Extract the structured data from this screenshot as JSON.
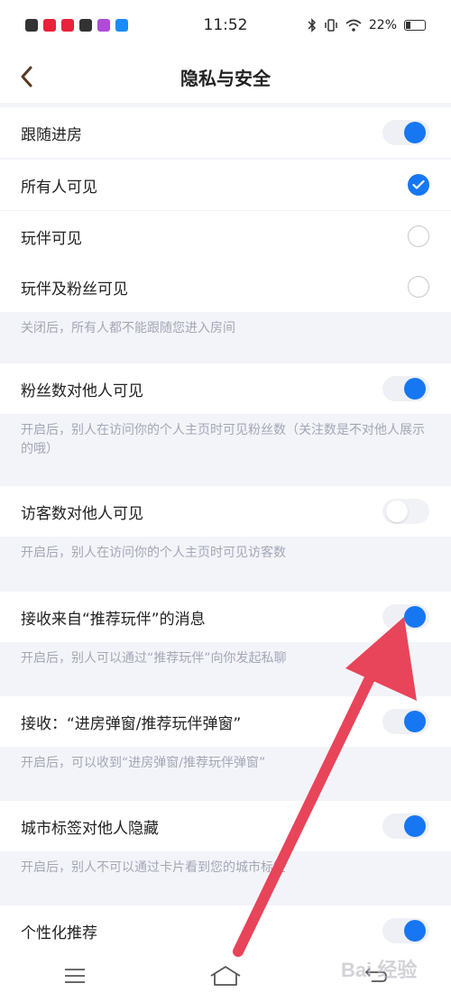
{
  "status": {
    "time": "11:52",
    "battery": "22%",
    "app_icon_colors": [
      "#333333",
      "#e8223a",
      "#e8223a",
      "#333333",
      "#b04bd8",
      "#1a8cff"
    ]
  },
  "nav": {
    "title": "隐私与安全",
    "back_icon": "chevron-left-icon"
  },
  "settings": {
    "follow": {
      "label": "跟随进房",
      "on": true
    },
    "options": [
      {
        "label": "所有人可见",
        "selected": true
      },
      {
        "label": "玩伴可见",
        "selected": false
      },
      {
        "label": "玩伴及粉丝可见",
        "selected": false
      }
    ],
    "follow_desc": "关闭后，所有人都不能跟随您进入房间",
    "fans": {
      "label": "粉丝数对他人可见",
      "on": true
    },
    "fans_desc": "开启后，别人在访问你的个人主页时可见粉丝数（关注数是不对他人展示的哦）",
    "visitors": {
      "label": "访客数对他人可见",
      "on": false
    },
    "visitors_desc": "开启后，别人在访问你的个人主页时可见访客数",
    "recommend_msg": {
      "label": "接收来自“推荐玩伴”的消息",
      "on": true
    },
    "recommend_msg_desc": "开启后，别人可以通过“推荐玩伴”向你发起私聊",
    "popup": {
      "label": "接收：“进房弹窗/推荐玩伴弹窗”",
      "on": true
    },
    "popup_desc": "开启后，可以收到“进房弹窗/推荐玩伴弹窗”",
    "city_tag": {
      "label": "城市标签对他人隐藏",
      "on": true
    },
    "city_tag_desc": "开启后，别人不可以通过卡片看到您的城市标签",
    "personalized": {
      "label": "个性化推荐",
      "on": true
    }
  },
  "colors": {
    "accent": "#1777f2",
    "annotation_arrow": "#e8445a"
  },
  "watermark": "Bai 经验"
}
